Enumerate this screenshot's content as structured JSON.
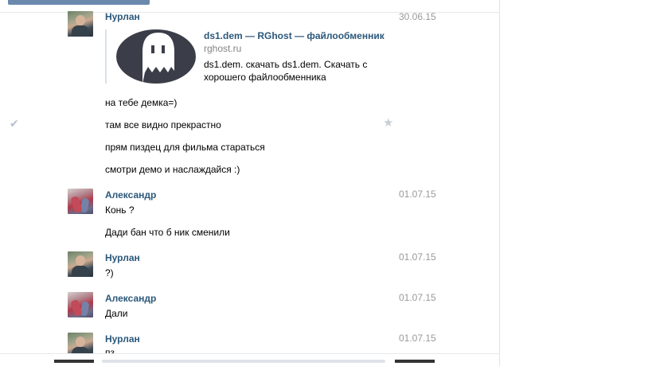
{
  "messages": [
    {
      "author": "Нурлан",
      "date": "30.06.15",
      "avatar": "nurlan"
    },
    {
      "author": "Александр",
      "date": "01.07.15",
      "avatar": "alex"
    },
    {
      "author": "Нурлан",
      "date": "01.07.15",
      "avatar": "nurlan"
    },
    {
      "author": "Александр",
      "date": "01.07.15",
      "avatar": "alex"
    },
    {
      "author": "Нурлан",
      "date": "01.07.15",
      "avatar": "nurlan"
    }
  ],
  "link_attachment": {
    "title": "ds1.dem — RGhost — файлообменник",
    "domain": "rghost.ru",
    "description": "ds1.dem. скачать ds1.dem. Скачать с хорошего файлообменника"
  },
  "lines": {
    "g1_l1": "на тебе демка=)",
    "g1_l2": "там все видно прекрастно",
    "g1_l3": "прям пиздец для фильма стараться",
    "g1_l4": "смотри демо и наслаждайся :)",
    "g2_l1": "Конь ?",
    "g2_l2": "Дади бан что б ник сменили",
    "g3_l1": "?)",
    "g4_l1": "Дали",
    "g5_l1": "пз"
  },
  "icons": {
    "check": "checkmark-icon",
    "star": "star-icon"
  }
}
